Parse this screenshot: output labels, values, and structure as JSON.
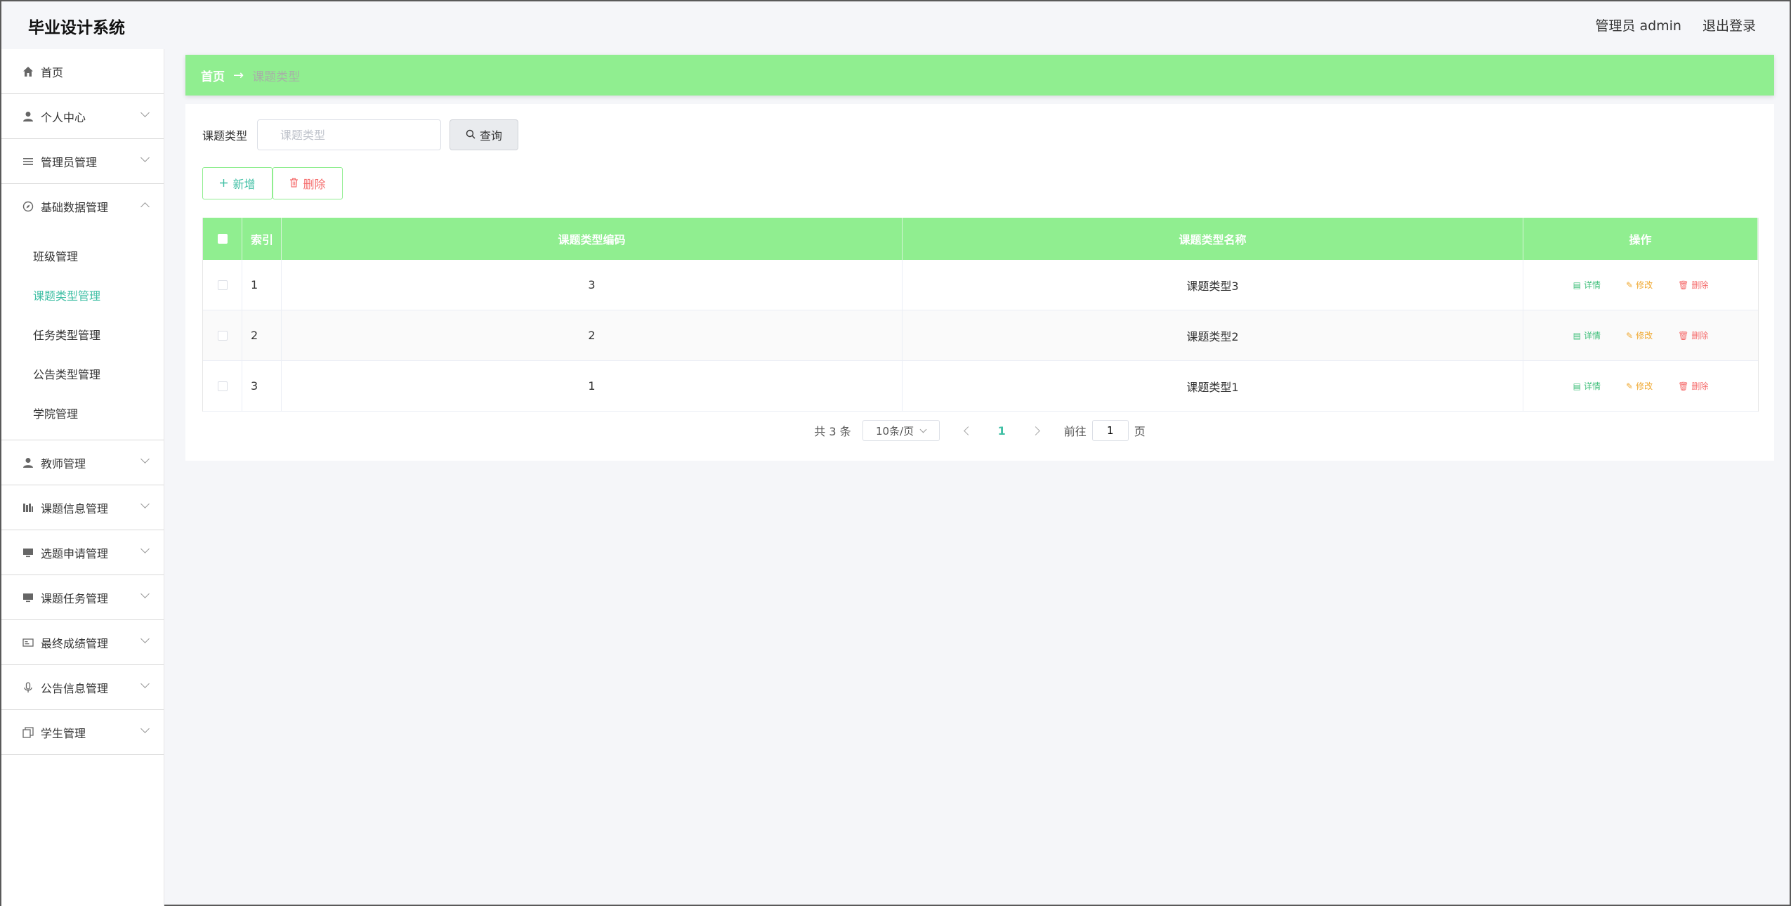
{
  "app": {
    "title": "毕业设计系统"
  },
  "header": {
    "user_label": "管理员 admin",
    "logout_label": "退出登录"
  },
  "sidebar": {
    "items": [
      {
        "label": "首页",
        "icon": "home-icon",
        "has_chevron": false
      },
      {
        "label": "个人中心",
        "icon": "user-icon",
        "has_chevron": true
      },
      {
        "label": "管理员管理",
        "icon": "list-icon",
        "has_chevron": true
      },
      {
        "label": "基础数据管理",
        "icon": "compass-icon",
        "has_chevron": true,
        "expanded": true
      },
      {
        "label": "教师管理",
        "icon": "user-icon",
        "has_chevron": true
      },
      {
        "label": "课题信息管理",
        "icon": "book-icon",
        "has_chevron": true
      },
      {
        "label": "选题申请管理",
        "icon": "monitor-icon",
        "has_chevron": true
      },
      {
        "label": "课题任务管理",
        "icon": "monitor-icon",
        "has_chevron": true
      },
      {
        "label": "最终成绩管理",
        "icon": "card-icon",
        "has_chevron": true
      },
      {
        "label": "公告信息管理",
        "icon": "mic-icon",
        "has_chevron": true
      },
      {
        "label": "学生管理",
        "icon": "copy-icon",
        "has_chevron": true
      }
    ],
    "subitems": [
      {
        "label": "班级管理"
      },
      {
        "label": "课题类型管理",
        "active": true
      },
      {
        "label": "任务类型管理"
      },
      {
        "label": "公告类型管理"
      },
      {
        "label": "学院管理"
      }
    ]
  },
  "breadcrumb": {
    "home": "首页",
    "separator": "→",
    "current": "课题类型"
  },
  "search": {
    "label": "课题类型",
    "placeholder": "课题类型",
    "button": "查询"
  },
  "actions": {
    "add": "新增",
    "delete": "删除"
  },
  "table": {
    "columns": [
      "索引",
      "课题类型编码",
      "课题类型名称",
      "操作"
    ],
    "rows": [
      {
        "index": "1",
        "code": "3",
        "name": "课题类型3"
      },
      {
        "index": "2",
        "code": "2",
        "name": "课题类型2"
      },
      {
        "index": "3",
        "code": "1",
        "name": "课题类型1"
      }
    ],
    "ops": {
      "detail": "详情",
      "edit": "修改",
      "delete": "删除"
    }
  },
  "pagination": {
    "total": "共 3 条",
    "page_size": "10条/页",
    "current_page": "1",
    "goto_label": "前往",
    "goto_value": "1",
    "page_unit": "页"
  },
  "colors": {
    "accent": "#90ee90",
    "active_text": "#3fbfa4",
    "danger": "#f56c6c",
    "warning": "#f0a830"
  }
}
